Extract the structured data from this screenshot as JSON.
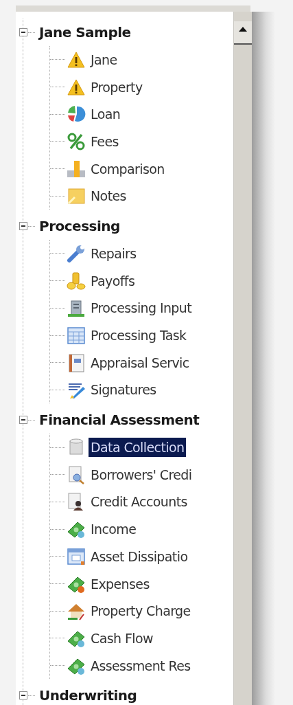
{
  "groups": [
    {
      "label": "Jane Sample",
      "expanded": true,
      "children": [
        {
          "label": "Jane",
          "selected": false
        },
        {
          "label": "Property",
          "selected": false
        },
        {
          "label": "Loan",
          "selected": false
        },
        {
          "label": "Fees",
          "selected": false
        },
        {
          "label": "Comparison",
          "selected": false
        },
        {
          "label": "Notes",
          "selected": false
        }
      ]
    },
    {
      "label": "Processing",
      "expanded": true,
      "children": [
        {
          "label": "Repairs",
          "selected": false
        },
        {
          "label": "Payoffs",
          "selected": false
        },
        {
          "label": "Processing Input",
          "selected": false
        },
        {
          "label": "Processing Task",
          "selected": false
        },
        {
          "label": "Appraisal Servic",
          "selected": false
        },
        {
          "label": "Signatures",
          "selected": false
        }
      ]
    },
    {
      "label": "Financial Assessment",
      "expanded": true,
      "children": [
        {
          "label": "Data Collection",
          "selected": true
        },
        {
          "label": "Borrowers' Credi",
          "selected": false
        },
        {
          "label": "Credit Accounts",
          "selected": false
        },
        {
          "label": "Income",
          "selected": false
        },
        {
          "label": "Asset Dissipatio",
          "selected": false
        },
        {
          "label": "Expenses",
          "selected": false
        },
        {
          "label": "Property Charge",
          "selected": false
        },
        {
          "label": "Cash Flow",
          "selected": false
        },
        {
          "label": "Assessment Res",
          "selected": false
        }
      ]
    },
    {
      "label": "Underwriting",
      "expanded": true
    }
  ]
}
